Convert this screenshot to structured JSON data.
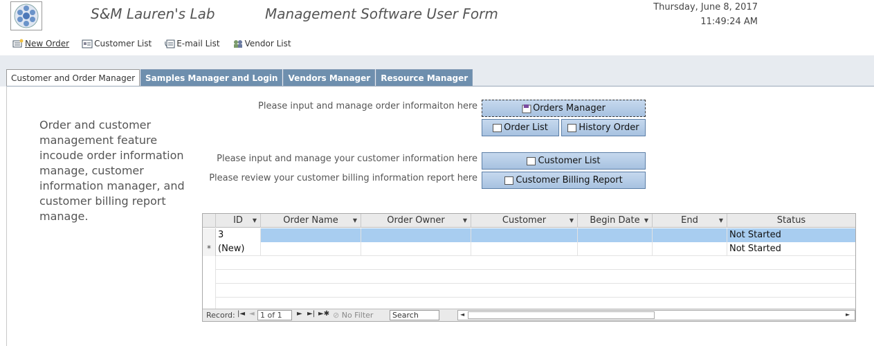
{
  "header": {
    "app_title": "S&M Lauren's Lab",
    "form_title": "Management Software User Form",
    "date": "Thursday, June 8, 2017",
    "time": "11:49:24 AM"
  },
  "toolbar": {
    "items": [
      {
        "label": "New Order",
        "icon": "new-order-icon"
      },
      {
        "label": "Customer List",
        "icon": "customer-list-icon"
      },
      {
        "label": "E-mail List",
        "icon": "email-list-icon"
      },
      {
        "label": "Vendor List",
        "icon": "vendor-list-icon"
      }
    ]
  },
  "tabs": [
    {
      "label": "Customer and Order Manager",
      "active": true
    },
    {
      "label": "Samples Manager and Login",
      "active": false
    },
    {
      "label": "Vendors Manager",
      "active": false
    },
    {
      "label": "Resource Manager",
      "active": false
    }
  ],
  "description": "Order and customer management feature incoude order  information manage, customer information manager, and customer billing report manage.",
  "prompts": {
    "order": "Please input and manage order informaiton here",
    "customer": "Please input and manage your customer information here",
    "billing": "Please review your customer billing information report here"
  },
  "buttons": {
    "orders_manager": "Orders Manager",
    "order_list": "Order List",
    "history_order": "History Order",
    "customer_list": "Customer List",
    "billing_report": "Customer Billing Report"
  },
  "grid": {
    "columns": [
      "ID",
      "Order Name",
      "Order Owner",
      "Customer",
      "Begin Date",
      "End",
      "Status"
    ],
    "rows": [
      {
        "selector": "",
        "ID": "3",
        "Order Name": "",
        "Order Owner": "",
        "Customer": "",
        "Begin Date": "",
        "End": "",
        "Status": "Not Started"
      },
      {
        "selector": "*",
        "ID": "(New)",
        "Order Name": "",
        "Order Owner": "",
        "Customer": "",
        "Begin Date": "",
        "End": "",
        "Status": "Not Started"
      }
    ]
  },
  "navigation": {
    "record_label": "Record:",
    "position": "1 of 1",
    "filter_label": "No Filter",
    "search_placeholder": "Search"
  }
}
